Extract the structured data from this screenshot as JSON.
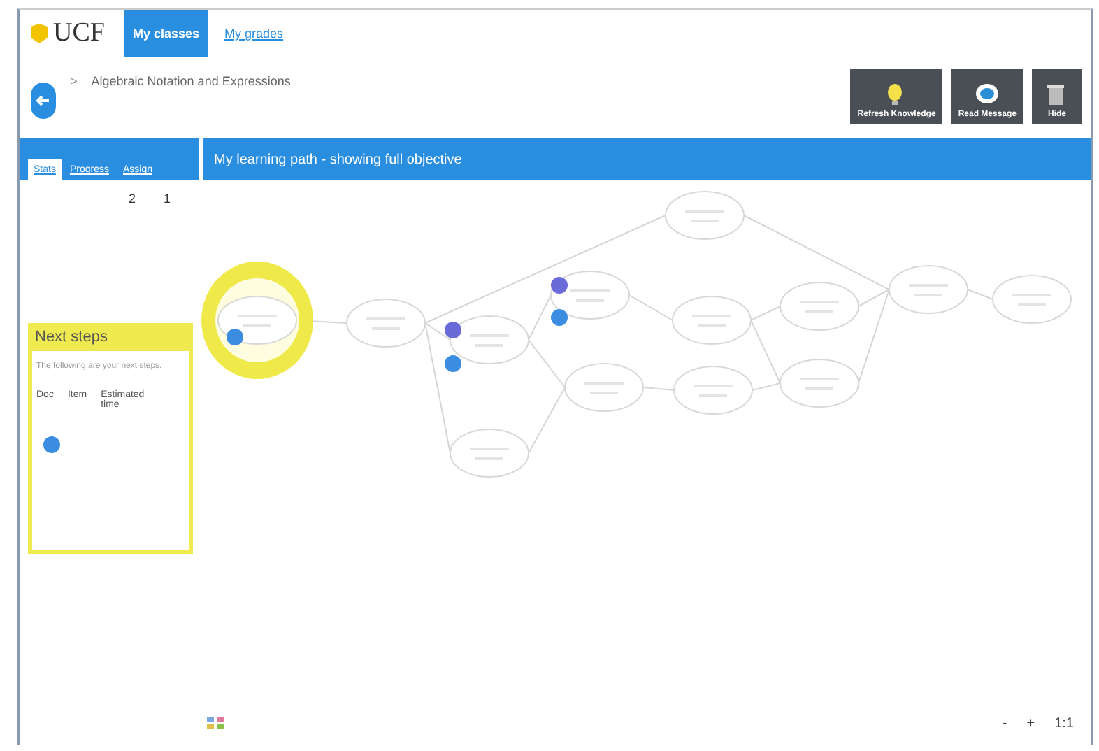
{
  "header": {
    "logo": "UCF",
    "nav_tabs": [
      {
        "label": "My classes",
        "selected": true
      },
      {
        "label": "My grades",
        "selected": false
      }
    ]
  },
  "breadcrumb": {
    "separator": ">",
    "title": "Algebraic Notation and Expressions"
  },
  "actions": [
    {
      "label": "Refresh Knowledge",
      "kind": "bulb"
    },
    {
      "label": "Read Message",
      "kind": "chat"
    },
    {
      "label": "Hide",
      "kind": "trash"
    }
  ],
  "side_tabs": [
    {
      "label": "Stats",
      "selected": true
    },
    {
      "label": "Progress",
      "selected": false
    },
    {
      "label": "Assign",
      "selected": false
    }
  ],
  "path_header": "My learning path - showing full objective",
  "stats": {
    "columns": [
      "2",
      "1"
    ]
  },
  "next_steps": {
    "title": "Next steps",
    "intro": "The following are your next steps.",
    "columns": [
      "Doc",
      "Item",
      "Estimated time"
    ]
  },
  "zoom_controls": [
    "-",
    "+",
    "1:1"
  ]
}
